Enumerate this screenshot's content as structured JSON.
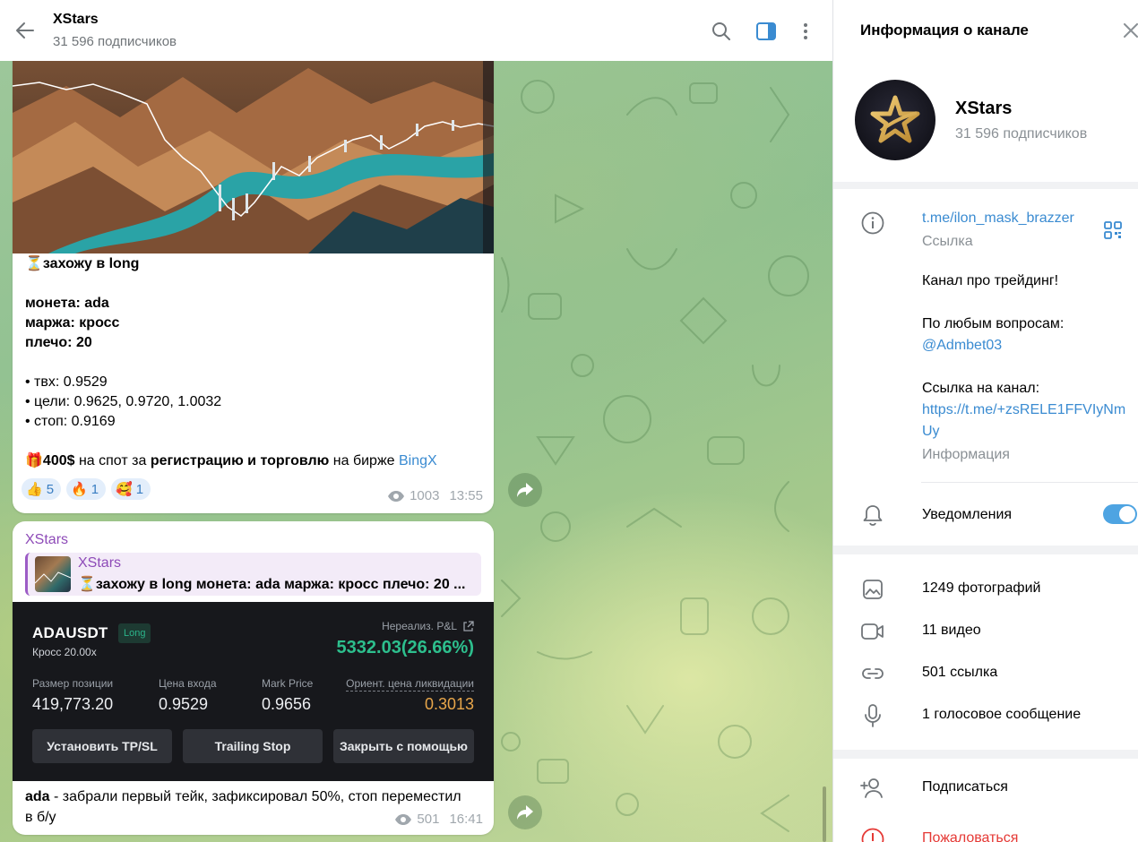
{
  "chat_header": {
    "title": "XStars",
    "subtitle": "31 596 подписчиков"
  },
  "message1": {
    "lines": {
      "l1": "захожу в long",
      "l2": "монета: ada",
      "l3": "маржа: кросс",
      "l4": "плечо: 20",
      "l5": "• твх: 0.9529",
      "l6": "• цели: 0.9625, 0.9720, 1.0032",
      "l7": "• стоп: 0.9169"
    },
    "promo": {
      "part1": "400$",
      "part2": " на спот за ",
      "part3": "регистрацию и торговлю",
      "part4": " на бирже ",
      "link": "BingX"
    },
    "reactions": [
      {
        "emoji": "👍",
        "count": "5"
      },
      {
        "emoji": "🔥",
        "count": "1"
      },
      {
        "emoji": "🥰",
        "count": "1"
      }
    ],
    "views": "1003",
    "time": "13:55"
  },
  "message2": {
    "author": "XStars",
    "reply": {
      "author": "XStars",
      "text": "захожу в long  монета: ada маржа: кросс плечо: 20 ..."
    },
    "position": {
      "symbol": "ADAUSDT",
      "side": "Long",
      "margin": "Кросс 20.00x",
      "pnl_label": "Нереализ. P&L",
      "pnl_value": "5332.03(26.66%)",
      "size_label": "Размер позиции",
      "size_value": "419,773.20",
      "entry_label": "Цена входа",
      "entry_value": "0.9529",
      "mark_label": "Mark Price",
      "mark_value": "0.9656",
      "liq_label": "Ориент. цена ликвидации",
      "liq_value": "0.3013",
      "btn_tpsl": "Установить TP/SL",
      "btn_trailing": "Trailing Stop",
      "btn_close": "Закрыть с помощью"
    },
    "text_bold": "ada",
    "text_rest": " - забрали первый тейк, зафиксировал 50%, стоп переместил",
    "text_line2": "в б/у",
    "views": "501",
    "time": "16:41"
  },
  "info_panel": {
    "title": "Информация о канале",
    "name": "XStars",
    "subscribers": "31 596 подписчиков",
    "link": "t.me/ilon_mask_brazzer",
    "link_label": "Ссылка",
    "desc1": "Канал про трейдинг!",
    "desc2": "По любым вопросам:",
    "desc_mention": "@Admbet03",
    "desc3": "Ссылка на канал:",
    "desc_link1": "https://t.me/+zsRELE1FFVIyNm",
    "desc_link2": "Uy",
    "desc_label": "Информация",
    "notifications": "Уведомления",
    "notifications_on": true,
    "media": {
      "photos": "1249 фотографий",
      "videos": "11 видео",
      "links": "501 ссылка",
      "voice": "1 голосовое сообщение"
    },
    "subscribe": "Подписаться",
    "report": "Пожаловаться"
  },
  "colors": {
    "accent": "#3a8bd1",
    "author": "#8e4bb8",
    "pnl_green": "#2dbf8d",
    "liq_orange": "#e8a64a",
    "danger": "#e53935"
  }
}
